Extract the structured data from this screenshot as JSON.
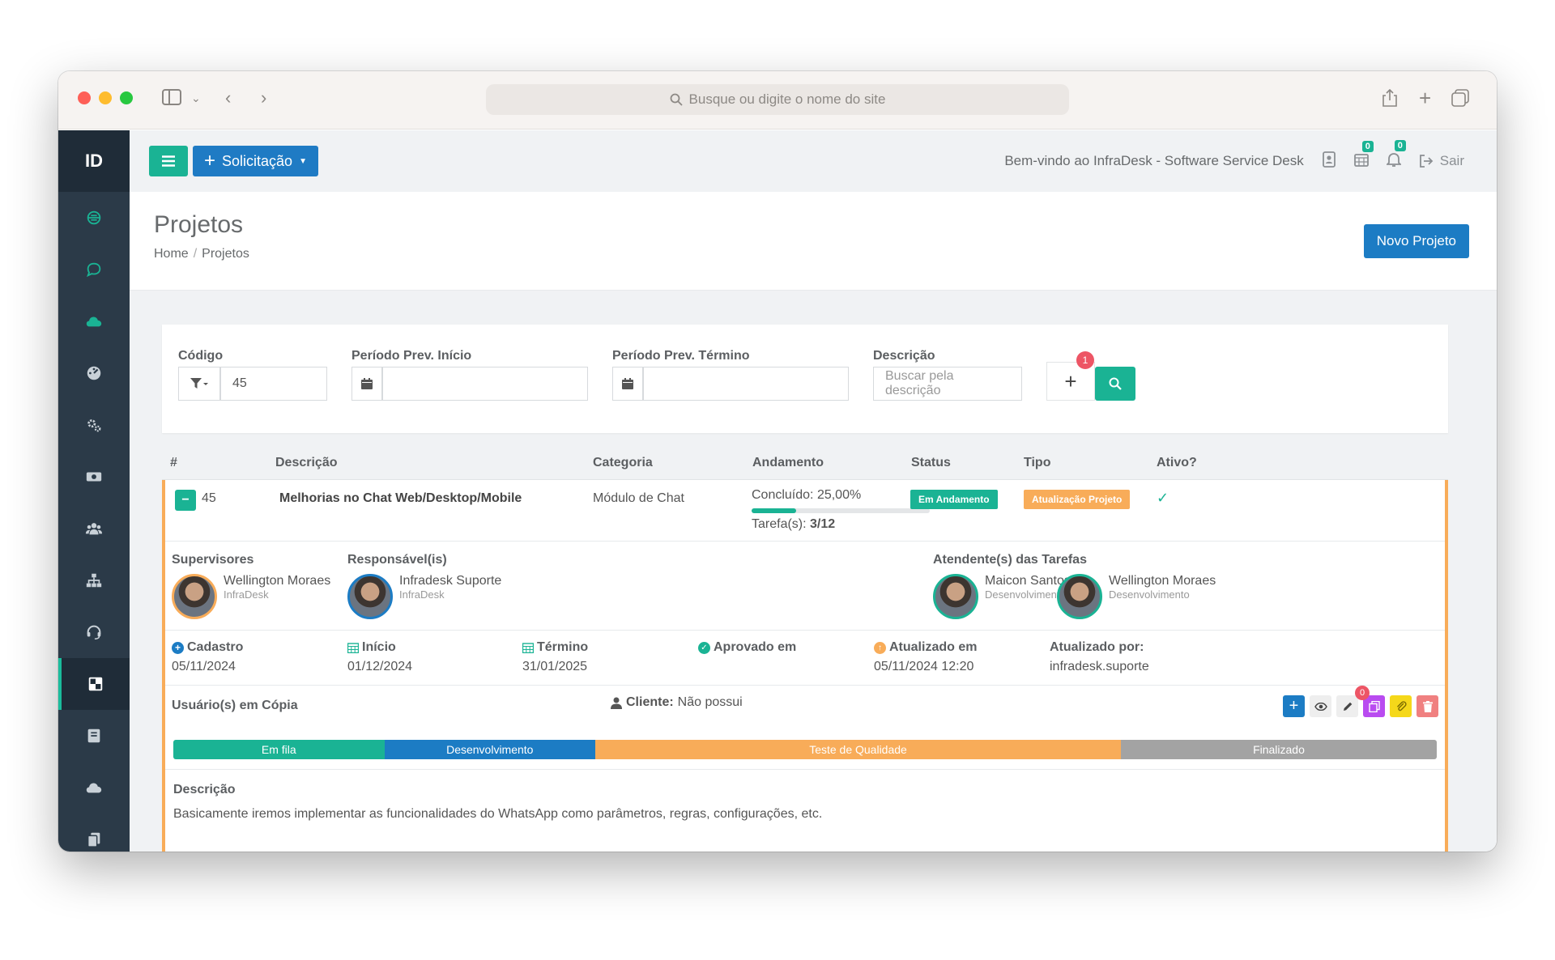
{
  "browser": {
    "url_placeholder": "Busque ou digite o nome do site"
  },
  "sidebar": {
    "logo": "ID",
    "items": [
      {
        "icon": "headset-icon"
      },
      {
        "icon": "chat-icon"
      },
      {
        "icon": "cloud-icon"
      },
      {
        "icon": "dashboard-icon"
      },
      {
        "icon": "gears-icon"
      },
      {
        "icon": "money-icon"
      },
      {
        "icon": "users-icon"
      },
      {
        "icon": "sitemap-icon"
      },
      {
        "icon": "support-icon"
      },
      {
        "icon": "projects-icon",
        "active": true
      },
      {
        "icon": "book-icon"
      },
      {
        "icon": "cloud-icon"
      },
      {
        "icon": "copy-icon"
      }
    ]
  },
  "topbar": {
    "new_request": "Solicitação",
    "welcome": "Bem-vindo ao InfraDesk - Software Service Desk",
    "badge_calendar": "0",
    "badge_bell": "0",
    "logout": "Sair"
  },
  "page": {
    "title": "Projetos",
    "breadcrumb": [
      "Home",
      "Projetos"
    ],
    "new_button": "Novo Projeto"
  },
  "filters": {
    "codigo_label": "Código",
    "codigo_value": "45",
    "inicio_label": "Período Prev. Início",
    "termino_label": "Período Prev. Término",
    "descricao_label": "Descrição",
    "descricao_placeholder": "Buscar pela descrição",
    "add_badge": "1"
  },
  "table": {
    "headers": [
      "#",
      "Descrição",
      "Categoria",
      "Andamento",
      "Status",
      "Tipo",
      "Ativo?"
    ],
    "row": {
      "id": "45",
      "descricao": "Melhorias no Chat Web/Desktop/Mobile",
      "categoria": "Módulo de Chat",
      "concluido_label": "Concluído: 25,00%",
      "progress": 0.25,
      "tarefas_label": "Tarefa(s):",
      "tarefas_value": "3/12",
      "status": "Em Andamento",
      "tipo": "Atualização Projeto",
      "ativo": "✓"
    }
  },
  "detail": {
    "supervisores_label": "Supervisores",
    "supervisor": {
      "name": "Wellington Moraes",
      "org": "InfraDesk"
    },
    "responsaveis_label": "Responsável(is)",
    "responsavel": {
      "name": "Infradesk Suporte",
      "org": "InfraDesk"
    },
    "atendentes_label": "Atendente(s) das Tarefas",
    "atendentes": [
      {
        "name": "Maicon Santos",
        "org": "Desenvolvimento"
      },
      {
        "name": "Wellington Moraes",
        "org": "Desenvolvimento"
      }
    ],
    "cadastro_label": "Cadastro",
    "cadastro_value": "05/11/2024",
    "inicio_label": "Início",
    "inicio_value": "01/12/2024",
    "termino_label": "Término",
    "termino_value": "31/01/2025",
    "aprovado_label": "Aprovado em",
    "atualizado_label": "Atualizado em",
    "atualizado_value": "05/11/2024 12:20",
    "atualizado_por_label": "Atualizado por:",
    "atualizado_por_value": "infradesk.suporte",
    "copia_label": "Usuário(s) em Cópia",
    "cliente_label": "Cliente:",
    "cliente_value": "Não possui",
    "attach_badge": "0",
    "stages": [
      {
        "label": "Em fila",
        "color": "#1ab394",
        "share": 16.7
      },
      {
        "label": "Desenvolvimento",
        "color": "#1c7cc4",
        "share": 16.7
      },
      {
        "label": "Teste de Qualidade",
        "color": "#f8ac59",
        "share": 41.6
      },
      {
        "label": "Finalizado",
        "color": "#a3a3a3",
        "share": 25.0
      }
    ],
    "descricao_label": "Descrição",
    "descricao_text": "Basicamente iremos implementar as funcionalidades do WhatsApp como parâmetros, regras, configurações, etc."
  },
  "colors": {
    "accent_green": "#1ab394",
    "accent_blue": "#1c7cc4",
    "warning_orange": "#f8ac59",
    "sidebar_bg": "#2b3a48"
  }
}
